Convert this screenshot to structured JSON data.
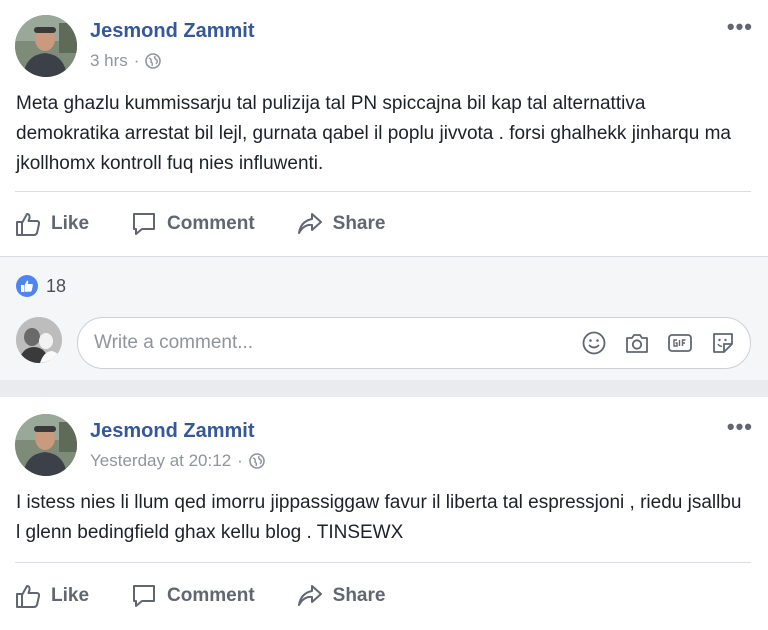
{
  "posts": [
    {
      "author": "Jesmond Zammit",
      "timestamp": "3 hrs",
      "separator": "·",
      "text": "Meta ghazlu kummissarju tal pulizija tal PN spiccajna bil kap tal alternattiva demokratika arrestat bil lejl, gurnata qabel il poplu jivvota . forsi ghalhekk jinharqu ma jkollhomx kontroll fuq nies influwenti.",
      "more": "•••"
    },
    {
      "author": "Jesmond Zammit",
      "timestamp": "Yesterday at 20:12",
      "separator": "·",
      "text": "I istess nies li llum qed imorru jippassiggaw favur il liberta tal espressjoni , riedu jsallbu l glenn bedingfield ghax kellu blog . TINSEWX",
      "more": "•••"
    }
  ],
  "actions": {
    "like": "Like",
    "comment": "Comment",
    "share": "Share"
  },
  "reactions": {
    "count": "18"
  },
  "comment_box": {
    "placeholder": "Write a comment..."
  },
  "colors": {
    "author": "#365899",
    "like_badge": "#4f85f3",
    "action_text": "#606770"
  }
}
